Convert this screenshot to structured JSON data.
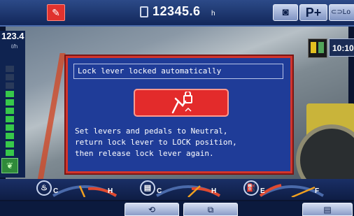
{
  "topbar": {
    "hour_meter": "12345.6",
    "hour_unit": "h",
    "btn_park": "P+",
    "btn_lo_label": "Lo",
    "icons": [
      "warning-lock-icon",
      "hourglass-icon",
      "camera-icon",
      "park-plus",
      "key-lo-icon"
    ]
  },
  "left_panel": {
    "fuel_rate": "123.4",
    "fuel_unit": "ℓ/h",
    "eco_bars": 8,
    "eco_bar_color": "#37c84a",
    "eco_bar_empty_color": "#2a3a5a"
  },
  "right_panel": {
    "clock": "10:10"
  },
  "dialog": {
    "title": "Lock lever locked automatically",
    "icon": "lock-lever-icon",
    "message": [
      "Set levers and pedals to Neutral,",
      "return lock lever to LOCK position,",
      "then release lock lever again."
    ],
    "border_color": "#d2342c",
    "bg_color": "#1f3c98"
  },
  "gauges": [
    {
      "name": "coolant",
      "icon": "coolant-temp-icon",
      "min": "C",
      "max": "H",
      "level": 0.35
    },
    {
      "name": "hydraulic",
      "icon": "hydraulic-temp-icon",
      "min": "C",
      "max": "H",
      "level": 0.6
    },
    {
      "name": "fuel",
      "icon": "fuel-icon",
      "min": "E",
      "max": "F",
      "level": 0.85
    }
  ],
  "bottom_buttons": [
    {
      "name": "camera-switch",
      "icon": "camera-switch-icon"
    },
    {
      "name": "camera-view",
      "icon": "camera-view-icon"
    },
    {
      "name": "menu",
      "icon": "menu-icon"
    }
  ]
}
